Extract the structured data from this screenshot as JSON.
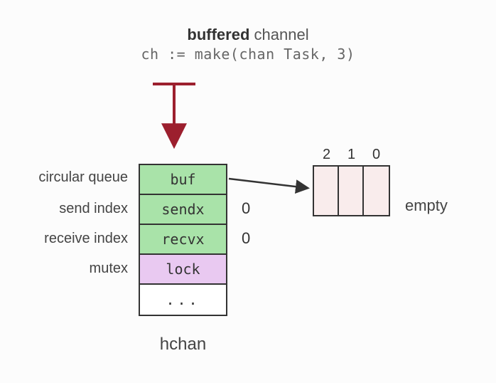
{
  "title": {
    "bold": "buffered",
    "rest": " channel"
  },
  "code_line": "ch := make(chan Task, 3)",
  "struct_name": "hchan",
  "fields": {
    "buf": {
      "label": "circular queue",
      "name": "buf",
      "value": ""
    },
    "sendx": {
      "label": "send index",
      "name": "sendx",
      "value": "0"
    },
    "recvx": {
      "label": "receive index",
      "name": "recvx",
      "value": "0"
    },
    "lock": {
      "label": "mutex",
      "name": "lock",
      "value": ""
    },
    "more": {
      "label": "",
      "name": "...",
      "value": ""
    }
  },
  "queue": {
    "indices": [
      "2",
      "1",
      "0"
    ],
    "state_label": "empty"
  }
}
